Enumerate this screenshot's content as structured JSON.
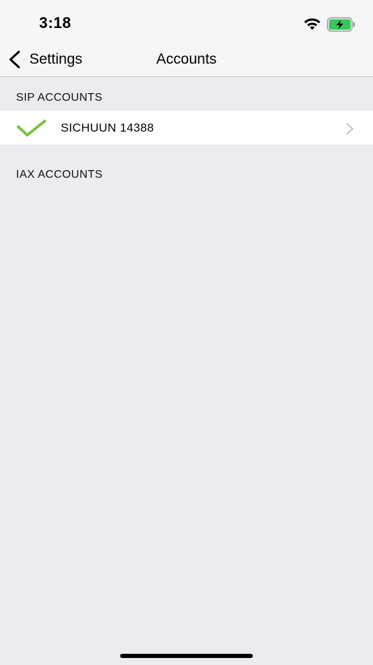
{
  "status_bar": {
    "time": "3:18",
    "wifi_icon": "wifi-icon",
    "battery_icon": "battery-charging-icon",
    "battery_color": "#35c759"
  },
  "nav": {
    "back_label": "Settings",
    "title": "Accounts",
    "back_icon": "chevron-left-icon"
  },
  "sections": {
    "sip": {
      "header": "SIP ACCOUNTS",
      "accounts": [
        {
          "name": "SICHUUN 14388",
          "active": true,
          "check_color": "#7cc142"
        }
      ]
    },
    "iax": {
      "header": "IAX ACCOUNTS",
      "accounts": []
    }
  }
}
